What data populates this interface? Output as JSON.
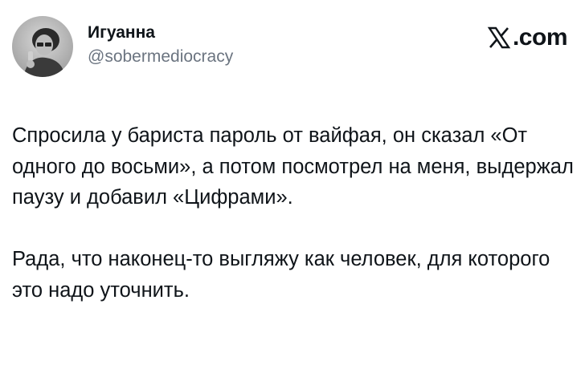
{
  "user": {
    "display_name": "Игуанна",
    "handle": "@sobermediocracy"
  },
  "brand": {
    "logo_icon": "x-logo-icon",
    "domain_suffix": ".com"
  },
  "tweet": {
    "paragraphs": [
      "Спросила у бариста пароль от вайфая, он сказал «От одного до восьми», а потом посмотрел на меня, выдержал паузу и добавил «Цифрами».",
      "Рада, что наконец-то выгляжу как человек, для которого это надо уточнить."
    ]
  },
  "colors": {
    "text": "#0f1419",
    "secondary": "#6b7480",
    "background": "#ffffff"
  }
}
